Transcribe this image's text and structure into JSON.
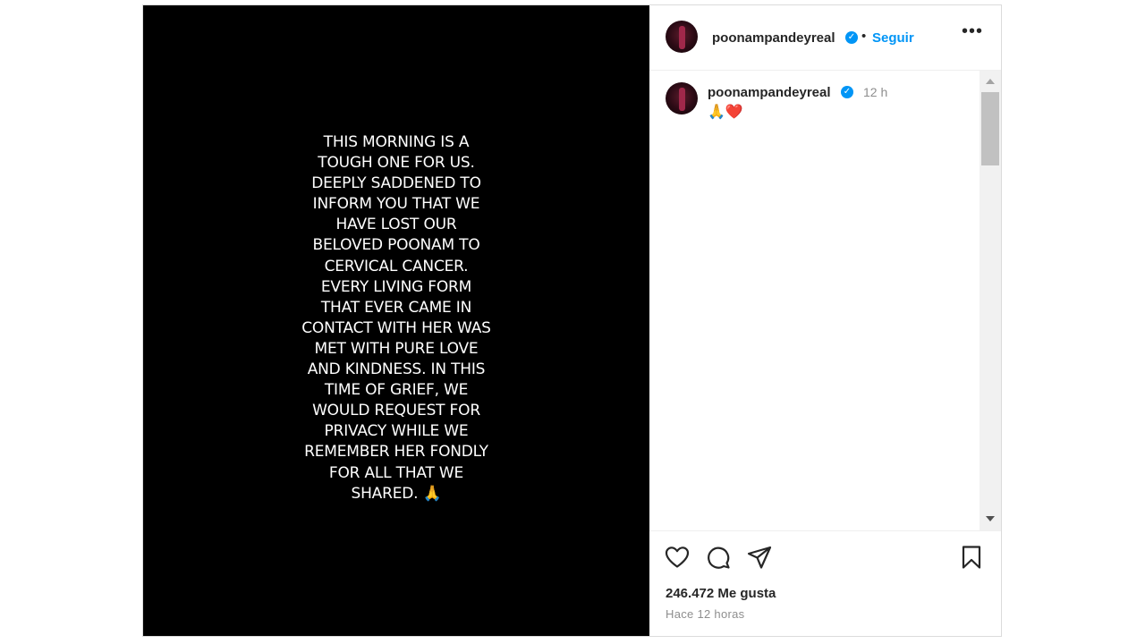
{
  "post": {
    "story_text": "THIS MORNING IS A\nTOUGH ONE FOR US.\nDEEPLY SADDENED TO\nINFORM YOU THAT WE\nHAVE LOST OUR\nBELOVED POONAM TO\nCERVICAL CANCER.\nEVERY LIVING FORM\nTHAT EVER CAME IN\nCONTACT WITH HER WAS\nMET WITH PURE LOVE\nAND KINDNESS. IN THIS\nTIME OF GRIEF, WE\nWOULD REQUEST FOR\nPRIVACY WHILE WE\nREMEMBER HER FONDLY\nFOR ALL THAT WE\nSHARED. 🙏"
  },
  "header": {
    "username": "poonampandeyreal",
    "verified_mark": "✓",
    "separator": "•",
    "follow_label": "Seguir",
    "more_label": "•••"
  },
  "comment": {
    "username": "poonampandeyreal",
    "verified_mark": "✓",
    "time": "12 h",
    "text": "🙏❤️"
  },
  "actions": {
    "likes": "246.472 Me gusta",
    "posted": "Hace 12 horas"
  },
  "icons": {
    "like": "heart-icon",
    "comment": "comment-bubble-icon",
    "share": "paper-plane-icon",
    "save": "bookmark-icon",
    "more": "more-horizontal-icon",
    "verified": "verified-badge-icon"
  },
  "colors": {
    "link_blue": "#0095f6",
    "verified_blue": "#0095f6",
    "text_dark": "#262626",
    "text_muted": "#8e8e8e",
    "media_background": "#000000"
  }
}
